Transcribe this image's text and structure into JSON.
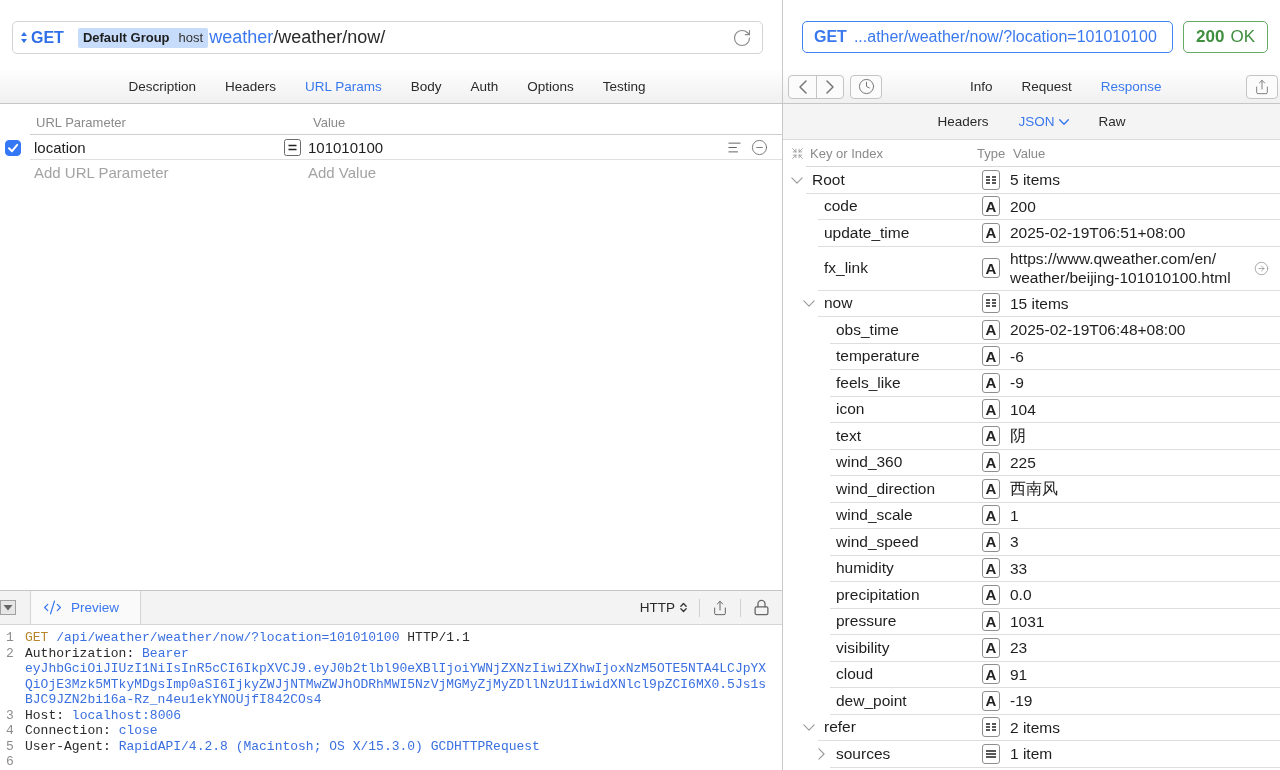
{
  "request": {
    "url_bar": {
      "method": "GET",
      "group": "Default Group",
      "host": "host",
      "url_variable": "weather",
      "url_path": "/weather/now/"
    },
    "tabs": [
      {
        "label": "Description",
        "selected": false
      },
      {
        "label": "Headers",
        "selected": false
      },
      {
        "label": "URL Params",
        "selected": true
      },
      {
        "label": "Body",
        "selected": false
      },
      {
        "label": "Auth",
        "selected": false
      },
      {
        "label": "Options",
        "selected": false
      },
      {
        "label": "Testing",
        "selected": false
      }
    ],
    "url_params": {
      "columns": [
        "URL Parameter",
        "Value"
      ],
      "rows": [
        {
          "checked": true,
          "name": "location",
          "value": "101010100"
        }
      ],
      "new_row": {
        "name_placeholder": "Add URL Parameter",
        "value_placeholder": "Add Value"
      }
    },
    "preview": {
      "tab_label": "Preview",
      "format": "HTTP",
      "lines": [
        {
          "number": "1",
          "parts": [
            {
              "kind": "method",
              "text": "GET"
            },
            {
              "kind": "value",
              "text": "/api/weather/weather/now/?location=101010100"
            },
            {
              "kind": "plain",
              "text": "HTTP/1.1"
            }
          ]
        },
        {
          "number": "2",
          "parts": [
            {
              "kind": "plain",
              "text": "Authorization:"
            },
            {
              "kind": "value",
              "text": "Bearer eyJhbGciOiJIUzI1NiIsInR5cCI6IkpXVCJ9.eyJ0b2tlbl90eXBlIjoiYWNjZXNzIiwiZXhwIjoxNzM5OTE5NTA4LCJpYXQiOjE3Mzk5MTkyMDgsImp0aSI6IjkyZWJjNTMwZWJhODRhMWI5NzVjMGMyZjMyZDllNzU1IiwidXNlcl9pZCI6MX0.5Js1sBJC9JZN2bi16a-Rz_n4eu1ekYNOUjfI842COs4"
            }
          ]
        },
        {
          "number": "3",
          "parts": [
            {
              "kind": "plain",
              "text": "Host:"
            },
            {
              "kind": "value",
              "text": "localhost:8006"
            }
          ]
        },
        {
          "number": "4",
          "parts": [
            {
              "kind": "plain",
              "text": "Connection:"
            },
            {
              "kind": "value",
              "text": "close"
            }
          ]
        },
        {
          "number": "5",
          "parts": [
            {
              "kind": "plain",
              "text": "User-Agent:"
            },
            {
              "kind": "value",
              "text": "RapidAPI/4.2.8 (Macintosh; OS X/15.3.0) GCDHTTPRequest"
            }
          ]
        },
        {
          "number": "6"
        }
      ]
    }
  },
  "response": {
    "summary": {
      "method": "GET",
      "url": "...ather/weather/now/?location=101010100"
    },
    "status": {
      "code": "200",
      "text": "OK"
    },
    "tabs": [
      {
        "label": "Info",
        "selected": false
      },
      {
        "label": "Request",
        "selected": false
      },
      {
        "label": "Response",
        "selected": true
      }
    ],
    "view_tabs": [
      {
        "label": "Headers",
        "selected": false,
        "dropdown": false
      },
      {
        "label": "JSON",
        "selected": true,
        "dropdown": true
      },
      {
        "label": "Raw",
        "selected": false,
        "dropdown": false
      }
    ],
    "columns": [
      "Key or Index",
      "Type",
      "Value"
    ],
    "tree": [
      {
        "key": "Root",
        "kind": "object",
        "value": "5 items",
        "expanded": true,
        "children": [
          {
            "key": "code",
            "kind": "string",
            "type_label": "A",
            "value": "200"
          },
          {
            "key": "update_time",
            "kind": "string",
            "type_label": "A",
            "value": "2025-02-19T06:51+08:00"
          },
          {
            "key": "fx_link",
            "kind": "link",
            "type_label": "A",
            "value": "https://www.qweather.com/en/weather/beijing-101010100.html"
          },
          {
            "key": "now",
            "kind": "object",
            "value": "15 items",
            "expanded": true,
            "children": [
              {
                "key": "obs_time",
                "kind": "string",
                "type_label": "A",
                "value": "2025-02-19T06:48+08:00"
              },
              {
                "key": "temperature",
                "kind": "string",
                "type_label": "A",
                "value": "-6"
              },
              {
                "key": "feels_like",
                "kind": "string",
                "type_label": "A",
                "value": "-9"
              },
              {
                "key": "icon",
                "kind": "string",
                "type_label": "A",
                "value": "104"
              },
              {
                "key": "text",
                "kind": "string",
                "type_label": "A",
                "value": "阴"
              },
              {
                "key": "wind_360",
                "kind": "string",
                "type_label": "A",
                "value": "225"
              },
              {
                "key": "wind_direction",
                "kind": "string",
                "type_label": "A",
                "value": "西南风"
              },
              {
                "key": "wind_scale",
                "kind": "string",
                "type_label": "A",
                "value": "1"
              },
              {
                "key": "wind_speed",
                "kind": "string",
                "type_label": "A",
                "value": "3"
              },
              {
                "key": "humidity",
                "kind": "string",
                "type_label": "A",
                "value": "33"
              },
              {
                "key": "precipitation",
                "kind": "string",
                "type_label": "A",
                "value": "0.0"
              },
              {
                "key": "pressure",
                "kind": "string",
                "type_label": "A",
                "value": "1031"
              },
              {
                "key": "visibility",
                "kind": "string",
                "type_label": "A",
                "value": "23"
              },
              {
                "key": "cloud",
                "kind": "string",
                "type_label": "A",
                "value": "91"
              },
              {
                "key": "dew_point",
                "kind": "string",
                "type_label": "A",
                "value": "-19"
              }
            ]
          },
          {
            "key": "refer",
            "kind": "object",
            "value": "2 items",
            "expanded": true,
            "children": [
              {
                "key": "sources",
                "kind": "array",
                "value": "1 item",
                "expanded": false
              }
            ]
          }
        ]
      }
    ]
  }
}
